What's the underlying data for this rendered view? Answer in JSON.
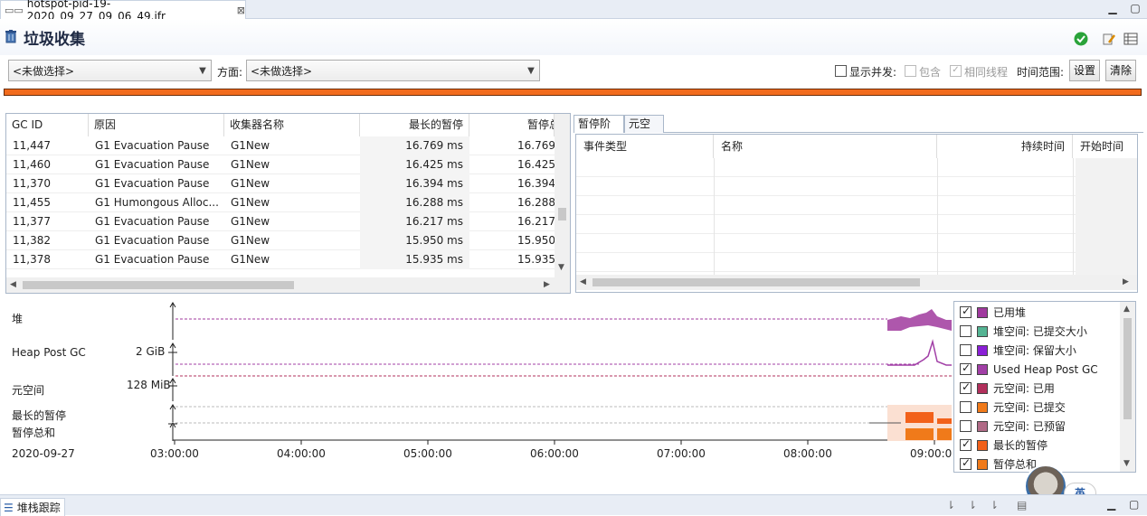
{
  "editor_tab": {
    "title": "hotspot-pid-19-2020_09_27_09_06_49.jfr",
    "close": "⊠"
  },
  "header": {
    "title": "垃圾收集"
  },
  "filters": {
    "combo1": "<未做选择>",
    "aspect_label": "方面:",
    "combo2": "<未做选择>",
    "show_concurrent": "显示并发:",
    "include": "包含",
    "same_thread": "相同线程",
    "time_range": "时间范围:",
    "settings_btn": "设置",
    "clear_btn": "清除"
  },
  "gc_table": {
    "headers": [
      "GC ID",
      "原因",
      "收集器名称",
      "最长的暂停",
      "暂停总"
    ],
    "rows": [
      [
        "11,447",
        "G1 Evacuation Pause",
        "G1New",
        "16.769 ms",
        "16.769"
      ],
      [
        "11,460",
        "G1 Evacuation Pause",
        "G1New",
        "16.425 ms",
        "16.425"
      ],
      [
        "11,370",
        "G1 Evacuation Pause",
        "G1New",
        "16.394 ms",
        "16.394"
      ],
      [
        "11,455",
        "G1 Humongous Alloc...",
        "G1New",
        "16.288 ms",
        "16.288"
      ],
      [
        "11,377",
        "G1 Evacuation Pause",
        "G1New",
        "16.217 ms",
        "16.217"
      ],
      [
        "11,382",
        "G1 Evacuation Pause",
        "G1New",
        "15.950 ms",
        "15.950"
      ],
      [
        "11,378",
        "G1 Evacuation Pause",
        "G1New",
        "15.935 ms",
        "15.935"
      ]
    ]
  },
  "right_tabs": [
    "暂停阶段",
    "元空间"
  ],
  "event_table": {
    "headers": [
      "事件类型",
      "名称",
      "持续时间",
      "开始时间"
    ]
  },
  "chart": {
    "row_labels": [
      "堆",
      "Heap Post GC",
      "元空间",
      "最长的暂停",
      "暂停总和"
    ],
    "y_ticks": [
      "2 GiB",
      "128 MiB"
    ],
    "date": "2020-09-27",
    "x_ticks": [
      "03:00:00",
      "04:00:00",
      "05:00:00",
      "06:00:00",
      "07:00:00",
      "08:00:00",
      "09:00:00"
    ]
  },
  "legend": [
    {
      "label": "已用堆",
      "checked": true,
      "color": "#a0399e"
    },
    {
      "label": "堆空间: 已提交大小",
      "checked": false,
      "color": "#54b493"
    },
    {
      "label": "堆空间: 保留大小",
      "checked": false,
      "color": "#8a1fd6"
    },
    {
      "label": "Used Heap Post GC",
      "checked": true,
      "color": "#a13fa6"
    },
    {
      "label": "元空间: 已用",
      "checked": true,
      "color": "#b2305c"
    },
    {
      "label": "元空间: 已提交",
      "checked": false,
      "color": "#f07a1a"
    },
    {
      "label": "元空间: 已预留",
      "checked": false,
      "color": "#b06a86"
    },
    {
      "label": "最长的暂停",
      "checked": true,
      "color": "#f2611a"
    },
    {
      "label": "暂停总和",
      "checked": true,
      "color": "#f07a1a"
    }
  ],
  "bottom": {
    "stack_tab": "堆栈跟踪",
    "ime": "英"
  }
}
